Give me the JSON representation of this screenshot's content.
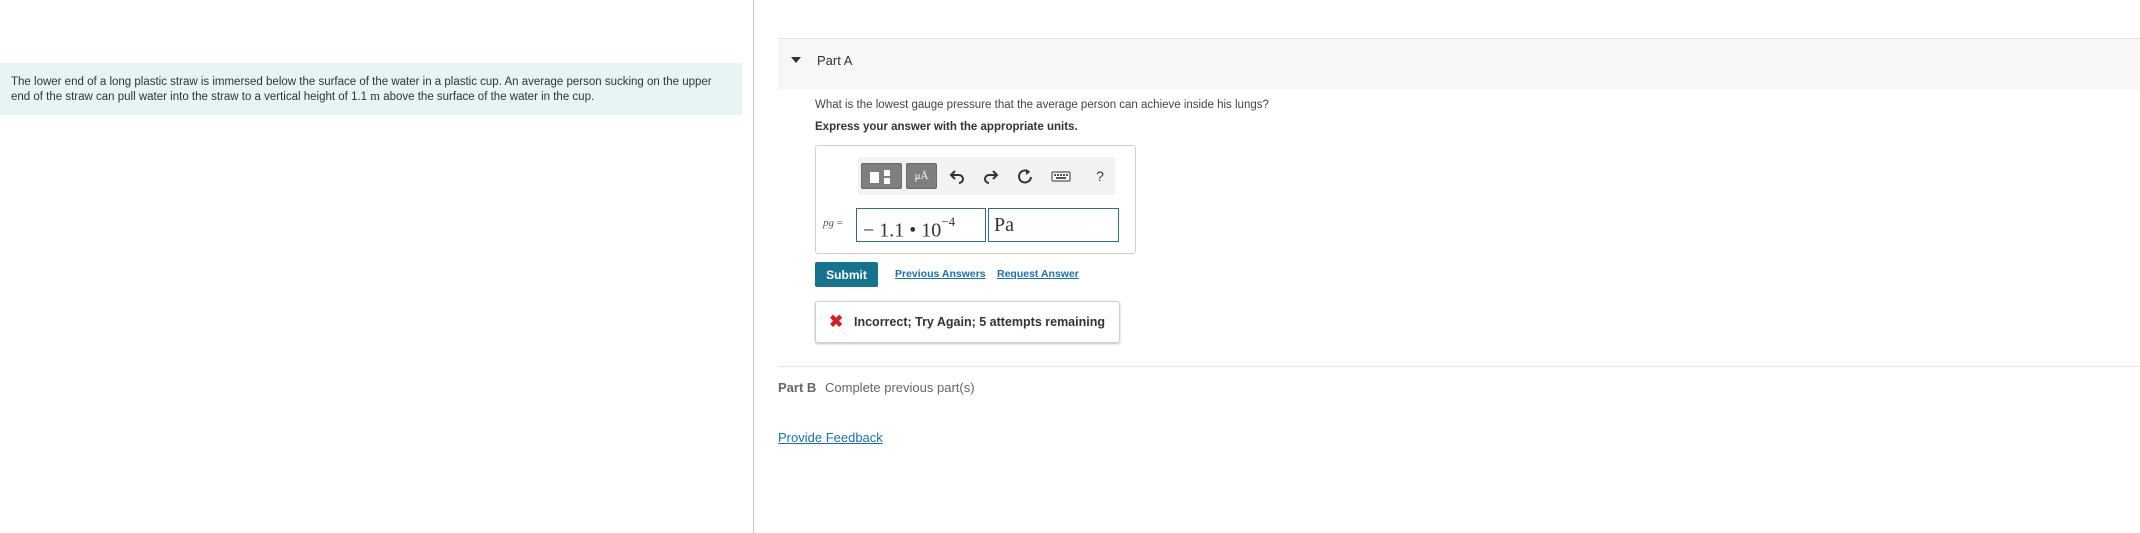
{
  "problem": {
    "text_before": "The lower end of a long plastic straw is immersed below the surface of the water in a plastic cup. An average person sucking on the upper end of the straw can pull water into the straw to a vertical height of 1.1 ",
    "unit": "m",
    "text_after": " above the surface of the water in the cup."
  },
  "part_a": {
    "title": "Part A",
    "question": "What is the lowest gauge pressure that the average person can achieve inside his lungs?",
    "instruction": "Express your answer with the appropriate units.",
    "toolbar": {
      "units_button_label": "μÅ",
      "icons": [
        "templates-icon",
        "units-icon",
        "undo-icon",
        "redo-icon",
        "reset-icon",
        "keyboard-icon",
        "help-icon"
      ],
      "help_label": "?"
    },
    "variable_label": "pg",
    "equals": "=",
    "answer_value_base": "− 1.1 • 10",
    "answer_value_exponent": "−4",
    "answer_units": "Pa",
    "submit_label": "Submit",
    "previous_answers_label": "Previous Answers",
    "request_answer_label": "Request Answer",
    "feedback": "Incorrect; Try Again; 5 attempts remaining"
  },
  "part_b": {
    "label": "Part B",
    "status": "Complete previous part(s)"
  },
  "provide_feedback_label": "Provide Feedback",
  "colors": {
    "problem_bg": "#e6f4f4",
    "submit_bg": "#15738e",
    "link": "#1a70b8",
    "error": "#d31f26",
    "field_border": "#2d6f8e"
  }
}
